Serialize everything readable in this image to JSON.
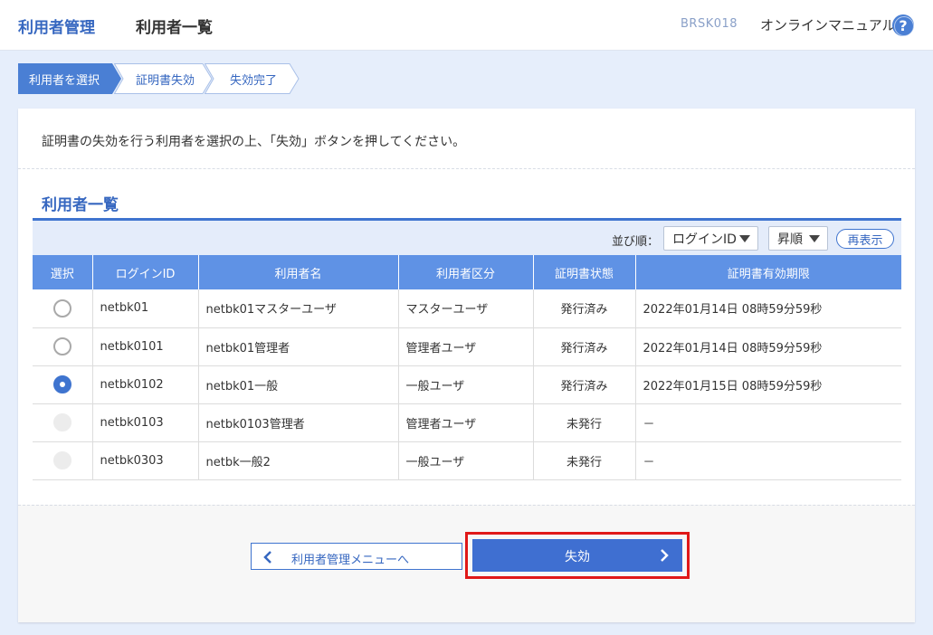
{
  "header": {
    "section": "利用者管理",
    "title": "利用者一覧",
    "screen_code": "BRSK018",
    "manual_link": "オンラインマニュアル",
    "help_icon": "?"
  },
  "steps": [
    {
      "label": "利用者を選択",
      "active": true
    },
    {
      "label": "証明書失効",
      "active": false
    },
    {
      "label": "失効完了",
      "active": false
    }
  ],
  "instruction": "証明書の失効を行う利用者を選択の上、「失効」ボタンを押してください。",
  "section_title": "利用者一覧",
  "sort": {
    "label": "並び順：",
    "field": "ログインID",
    "order": "昇順",
    "redisplay": "再表示"
  },
  "table": {
    "headers": [
      "選択",
      "ログインID",
      "利用者名",
      "利用者区分",
      "証明書状態",
      "証明書有効期限"
    ],
    "rows": [
      {
        "radio": "unchecked",
        "login_id": "netbk01",
        "name": "netbk01マスターユーザ",
        "type": "マスターユーザ",
        "status": "発行済み",
        "expiry": "2022年01月14日 08時59分59秒"
      },
      {
        "radio": "unchecked",
        "login_id": "netbk0101",
        "name": "netbk01管理者",
        "type": "管理者ユーザ",
        "status": "発行済み",
        "expiry": "2022年01月14日 08時59分59秒"
      },
      {
        "radio": "checked",
        "login_id": "netbk0102",
        "name": "netbk01一般",
        "type": "一般ユーザ",
        "status": "発行済み",
        "expiry": "2022年01月15日 08時59分59秒"
      },
      {
        "radio": "disabled",
        "login_id": "netbk0103",
        "name": "netbk0103管理者",
        "type": "管理者ユーザ",
        "status": "未発行",
        "expiry": "－"
      },
      {
        "radio": "disabled",
        "login_id": "netbk0303",
        "name": "netbk一般2",
        "type": "一般ユーザ",
        "status": "未発行",
        "expiry": "－"
      }
    ]
  },
  "buttons": {
    "back": "利用者管理メニューへ",
    "revoke": "失効"
  },
  "colors": {
    "accent": "#3667c0",
    "table_header": "#5f92e5",
    "highlight": "#e01818"
  }
}
